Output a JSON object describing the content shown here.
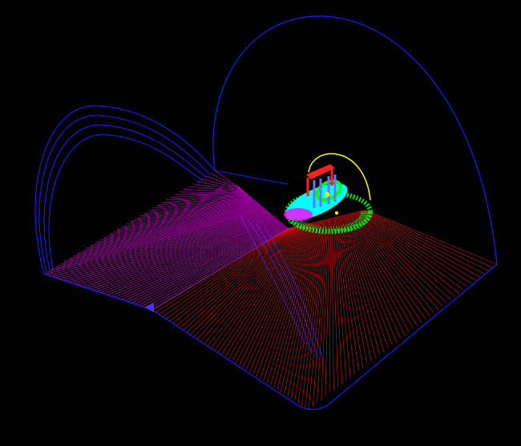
{
  "scene": {
    "background_color": "#000000",
    "colors": {
      "outline": "#1a1aff",
      "left_panel_lines": "#ff00ff",
      "right_panel_lines": "#ff1a1a",
      "ring_green": "#00ff00",
      "ring_cyan": "#00ffff",
      "frame_red": "#ff2020",
      "frame_blue": "#7070ff",
      "arc_yellow": "#ffff00"
    }
  }
}
